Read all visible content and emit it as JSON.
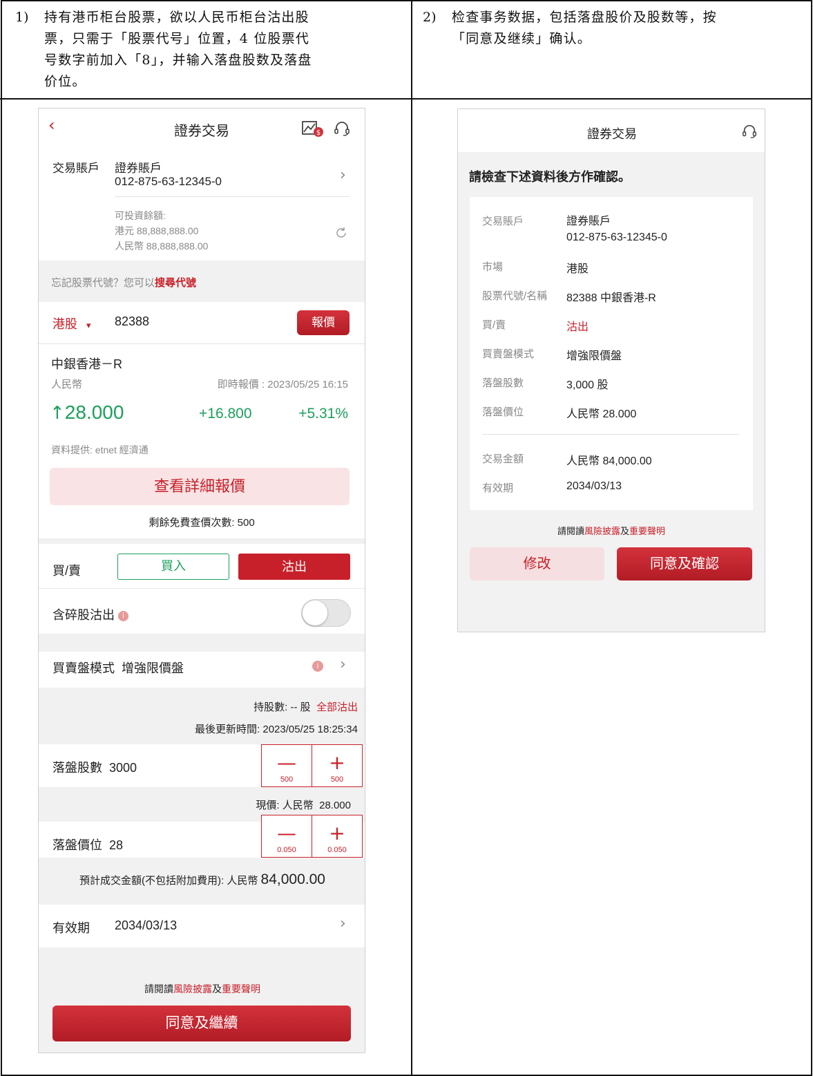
{
  "instructions": {
    "step1": {
      "num": "1)",
      "lines": [
        "持有港币柜台股票，欲以人民币柜台沽出股",
        "票，只需于「股票代号」位置，4 位股票代",
        "号数字前加入「8」，并输入落盘股数及落盘",
        "价位。"
      ]
    },
    "step2": {
      "num": "2)",
      "lines": [
        "检查事务数据，包括落盘股价及股数等，按",
        "「同意及继续」确认。"
      ]
    }
  },
  "screen1": {
    "back_icon": "chevron-left-icon",
    "title": "證券交易",
    "account": {
      "label": "交易賬戶",
      "type": "證券賬戶",
      "number": "012-875-63-12345-0"
    },
    "balance": {
      "label": "可投資餘額:",
      "hkd": "港元 88,888,888.00",
      "rmb": "人民幣 88,888,888.00"
    },
    "search_hint": {
      "prefix": "忘記股票代號？您可以",
      "link": "搜尋代號"
    },
    "market": {
      "label": "港股",
      "caret": "▾",
      "code": "82388",
      "quote_button": "報價"
    },
    "stock": {
      "name": "中銀香港－R",
      "currency": "人民幣",
      "timestamp": "即時報價 : 2023/05/25 16:15",
      "arrow": "↑",
      "price": "28.000",
      "change": "+16.800",
      "change_pct": "+5.31%",
      "provider": "資料提供: etnet 經濟通"
    },
    "detail_button": "查看詳細報價",
    "free_quotes": "剩餘免費查價次數: 500",
    "side": {
      "label": "買/賣",
      "buy": "買入",
      "sell": "沽出"
    },
    "odd_lot": {
      "label": "含碎股沽出",
      "toggle_on": false
    },
    "order_type": {
      "label": "買賣盤模式",
      "value": "增強限價盤"
    },
    "holding": {
      "text": "持股數: -- 股",
      "link": "全部沽出",
      "updated": "最後更新時間: 2023/05/25 18:25:34"
    },
    "quantity": {
      "label": "落盤股數",
      "value": "3000",
      "minus": "—",
      "plus": "+",
      "step": "500"
    },
    "current_price": {
      "label": "現價: 人民幣",
      "value": "28.000"
    },
    "price": {
      "label": "落盤價位",
      "value": "28",
      "minus": "—",
      "plus": "+",
      "step": "0.050"
    },
    "estimate": {
      "label": "預計成交金額(不包括附加費用): 人民幣",
      "value": "84,000.00"
    },
    "validity": {
      "label": "有效期",
      "value": "2034/03/13"
    },
    "disclaimer": {
      "prefix": "請閱讀",
      "risk": "風險披露",
      "and": "及",
      "important": "重要聲明"
    },
    "continue_button": "同意及繼續"
  },
  "screen2": {
    "title": "證券交易",
    "heading": "請檢查下述資料後方作確認。",
    "rows": [
      {
        "label": "交易賬戶",
        "value": "證券賬戶",
        "value2": "012-875-63-12345-0"
      },
      {
        "label": "市場",
        "value": "港股"
      },
      {
        "label": "股票代號/名稱",
        "value": "82388 中銀香港-R"
      },
      {
        "label": "買/賣",
        "value": "沽出"
      },
      {
        "label": "買賣盤模式",
        "value": "增強限價盤"
      },
      {
        "label": "落盤股數",
        "value": "3,000 股"
      },
      {
        "label": "落盤價位",
        "value": "人民幣 28.000"
      },
      {
        "label": "交易金額",
        "value": "人民幣 84,000.00"
      },
      {
        "label": "有效期",
        "value": "2034/03/13"
      }
    ],
    "disclaimer": {
      "prefix": "請閱讀",
      "risk": "風險披露",
      "and": "及",
      "important": "重要聲明"
    },
    "modify_button": "修改",
    "confirm_button": "同意及確認"
  },
  "colors": {
    "accent": "#c8202a",
    "up": "#1aa05a"
  }
}
